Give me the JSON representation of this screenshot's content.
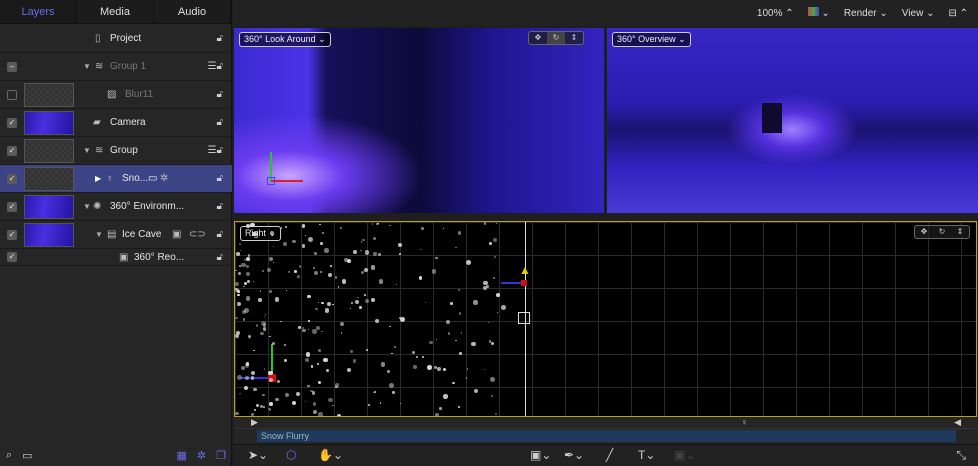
{
  "tabs": [
    {
      "label": "Layers"
    },
    {
      "label": "Media"
    },
    {
      "label": "Audio"
    }
  ],
  "layers": {
    "project": "Project",
    "group1": "Group 1",
    "blur": "Blur11",
    "camera": "Camera",
    "group": "Group",
    "snow": "Sno...",
    "env": "360° Environm...",
    "icecave": "Ice Cave",
    "reorient": "360° Reo..."
  },
  "topbar": {
    "zoom": "100% ⌃",
    "render": "Render ⌄",
    "view": "View ⌄"
  },
  "viewports": {
    "left": "360° Look Around ⌄",
    "right": "360° Overview ⌄",
    "bottom": "Right ⌄"
  },
  "timeline": {
    "clip": "Snow Flurry"
  },
  "colors": {
    "accent": "#6b6ef0",
    "selection": "#3d4485",
    "canvas_border": "#b8a020"
  }
}
